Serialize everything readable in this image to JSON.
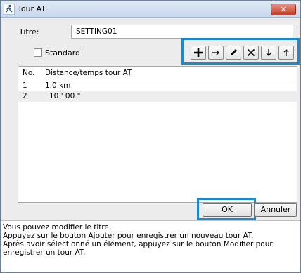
{
  "window": {
    "title": "Tour AT",
    "close_label": "✕"
  },
  "titre": {
    "label": "Titre:",
    "value": "SETTING01"
  },
  "standard": {
    "label": "Standard",
    "checked": false
  },
  "toolbar": {
    "buttons": [
      {
        "name": "add-button",
        "icon": "plus-icon"
      },
      {
        "name": "next-button",
        "icon": "arrow-right-icon"
      },
      {
        "name": "edit-button",
        "icon": "pencil-icon"
      },
      {
        "name": "delete-button",
        "icon": "x-icon"
      },
      {
        "name": "move-down-button",
        "icon": "arrow-down-icon"
      },
      {
        "name": "move-up-button",
        "icon": "arrow-up-icon"
      }
    ]
  },
  "list": {
    "headers": {
      "no": "No.",
      "distance": "Distance/temps tour AT"
    },
    "rows": [
      {
        "no": "1",
        "value": "1.0 km"
      },
      {
        "no": "2",
        "value": "10 ' 00 \""
      }
    ]
  },
  "buttons": {
    "ok": "OK",
    "cancel": "Annuler"
  },
  "help": {
    "line1": "Vous pouvez modifier le titre.",
    "line2": "Appuyez sur le bouton Ajouter pour enregistrer un nouveau tour AT.",
    "line3": "Après avoir sélectionné un élément, appuyez sur le bouton Modifier pour enregistrer un tour AT."
  },
  "colors": {
    "highlight": "#1a8ad0",
    "close": "#c2402b"
  }
}
